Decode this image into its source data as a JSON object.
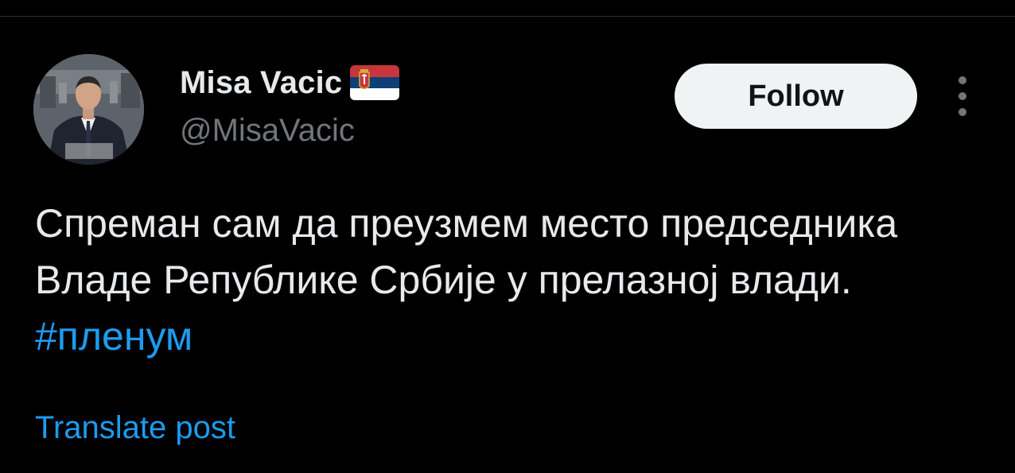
{
  "post": {
    "author": {
      "display_name": "Misa Vacic",
      "handle": "@MisaVacic",
      "badge_icon": "serbia-flag-icon"
    },
    "follow_label": "Follow",
    "more_icon": "more-vertical-icon",
    "text": "Спреман сам да преузмем место председника Владе Републике Србије у прелазној влади.",
    "hashtag": "#пленум",
    "translate_label": "Translate post"
  },
  "colors": {
    "background": "#000000",
    "primary_text": "#e7e9ea",
    "secondary_text": "#71767b",
    "link": "#1d9bf0",
    "follow_bg": "#eff3f4",
    "follow_text": "#0f1419",
    "divider": "#2f3336"
  }
}
